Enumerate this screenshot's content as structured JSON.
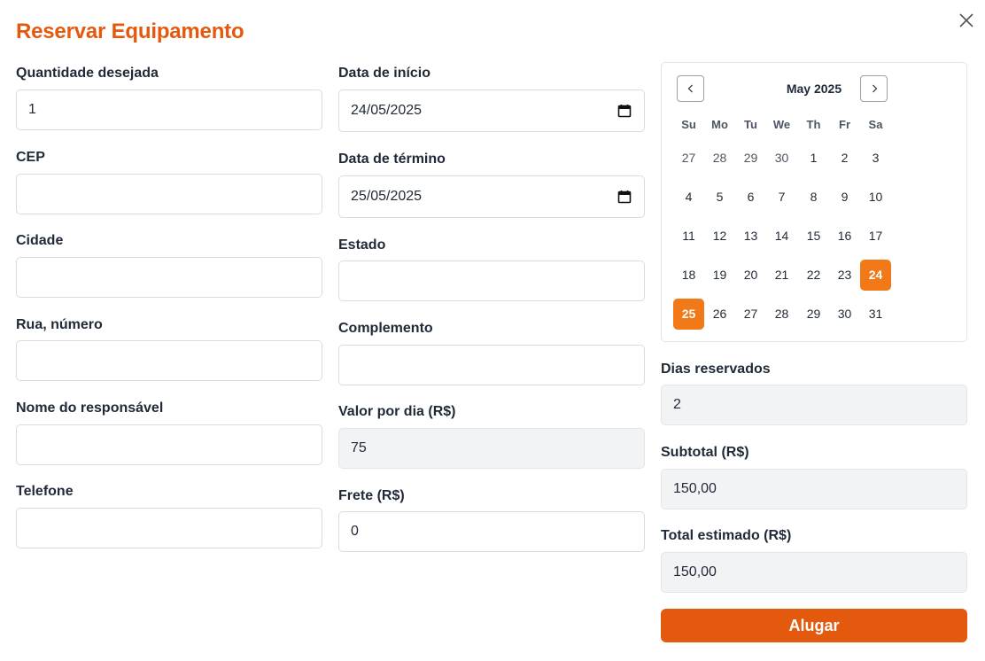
{
  "title": "Reservar Equipamento",
  "colors": {
    "accent": "#e35a0f",
    "selected_day": "#f17917"
  },
  "fields": {
    "quantidade": {
      "label": "Quantidade desejada",
      "value": "1"
    },
    "cep": {
      "label": "CEP",
      "value": ""
    },
    "cidade": {
      "label": "Cidade",
      "value": ""
    },
    "rua": {
      "label": "Rua, número",
      "value": ""
    },
    "responsavel": {
      "label": "Nome do responsável",
      "value": ""
    },
    "telefone": {
      "label": "Telefone",
      "value": ""
    },
    "data_inicio": {
      "label": "Data de início",
      "value": "24/05/2025"
    },
    "data_termino": {
      "label": "Data de término",
      "value": "25/05/2025"
    },
    "estado": {
      "label": "Estado",
      "value": ""
    },
    "complemento": {
      "label": "Complemento",
      "value": ""
    },
    "valor_dia": {
      "label": "Valor por dia (R$)",
      "value": "75"
    },
    "frete": {
      "label": "Frete (R$)",
      "value": "0"
    },
    "dias": {
      "label": "Dias reservados",
      "value": "2"
    },
    "subtotal": {
      "label": "Subtotal (R$)",
      "value": "150,00"
    },
    "total": {
      "label": "Total estimado (R$)",
      "value": "150,00"
    }
  },
  "calendar": {
    "month": "May 2025",
    "weekdays": [
      "Su",
      "Mo",
      "Tu",
      "We",
      "Th",
      "Fr",
      "Sa"
    ],
    "weeks": [
      [
        "27",
        "28",
        "29",
        "30",
        "1",
        "2",
        "3"
      ],
      [
        "4",
        "5",
        "6",
        "7",
        "8",
        "9",
        "10"
      ],
      [
        "11",
        "12",
        "13",
        "14",
        "15",
        "16",
        "17"
      ],
      [
        "18",
        "19",
        "20",
        "21",
        "22",
        "23",
        "24"
      ],
      [
        "25",
        "26",
        "27",
        "28",
        "29",
        "30",
        "31"
      ]
    ],
    "outside_days_first_week": 4,
    "selected": [
      "24",
      "25"
    ]
  },
  "rent_button": "Alugar",
  "icons": {
    "close": "close-icon",
    "prev": "chevron-left-icon",
    "next": "chevron-right-icon",
    "date": "calendar-icon"
  }
}
